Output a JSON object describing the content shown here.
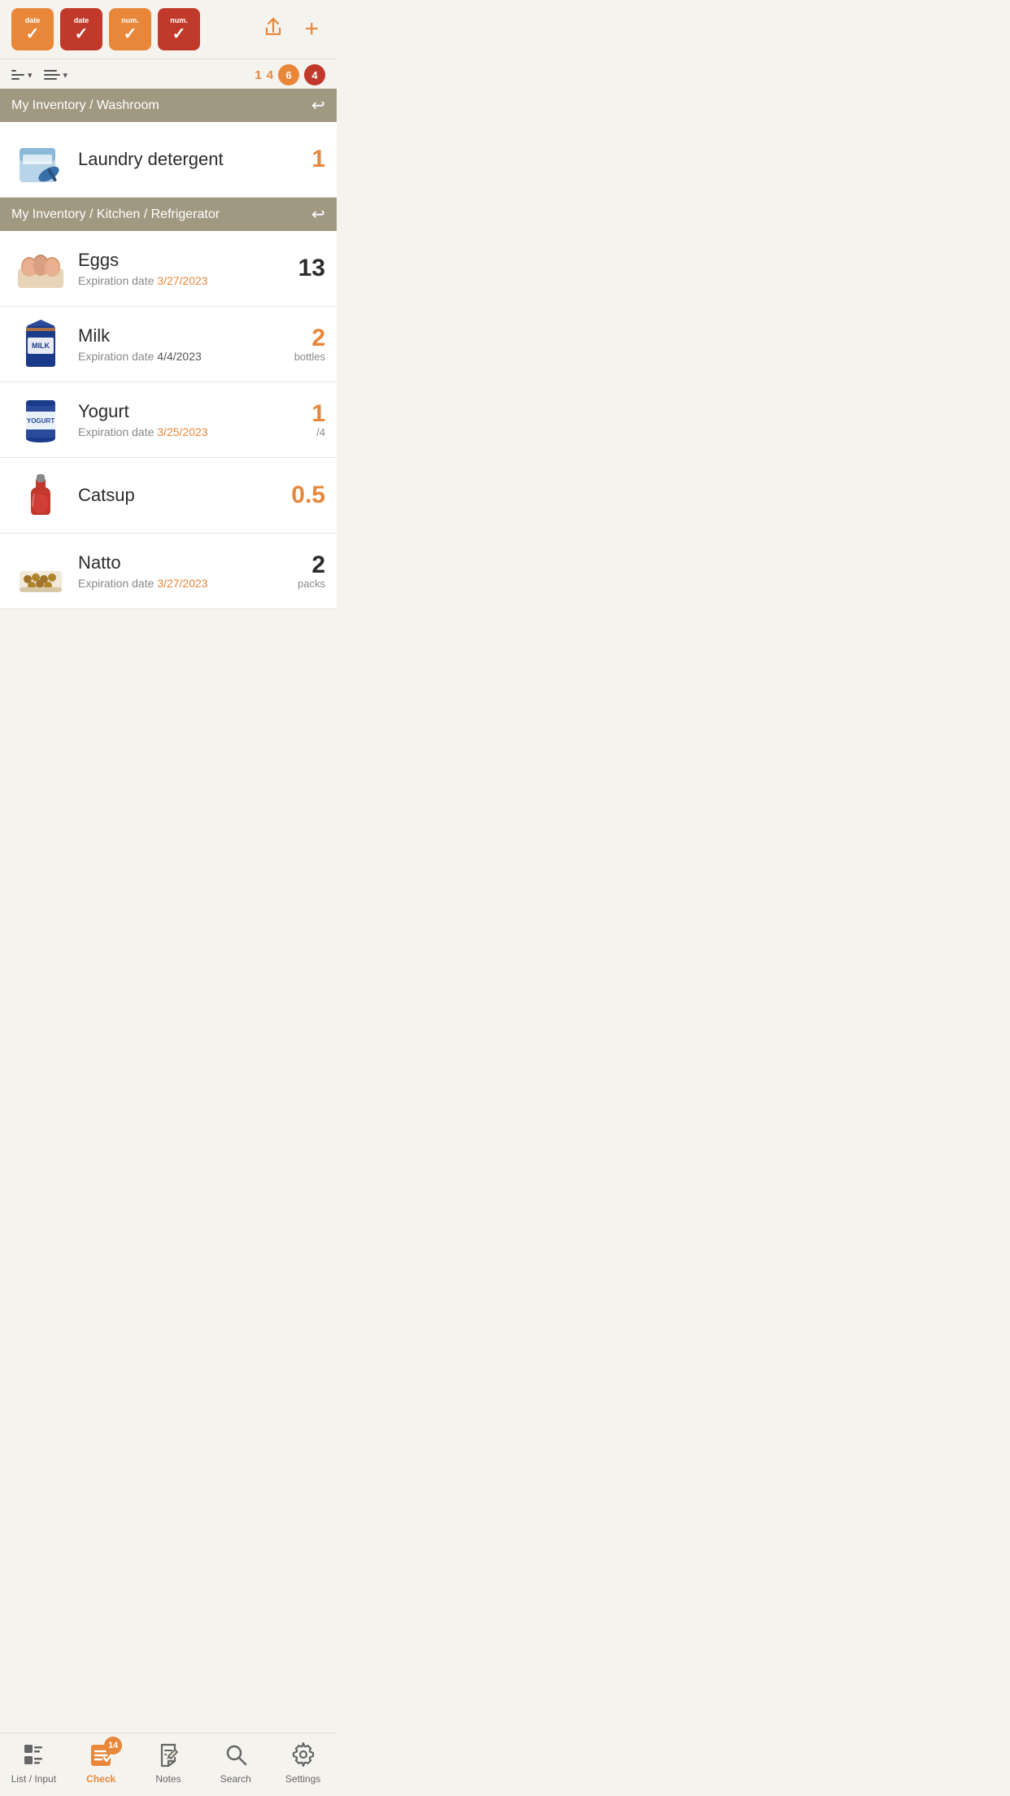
{
  "toolbar": {
    "filter_buttons": [
      {
        "label": "date",
        "type": "orange",
        "icon": "✓"
      },
      {
        "label": "date",
        "type": "red",
        "icon": "✓"
      },
      {
        "label": "num.",
        "type": "orange",
        "icon": "✓"
      },
      {
        "label": "num.",
        "type": "red",
        "icon": "✓"
      }
    ],
    "share_label": "Share",
    "add_label": "Add"
  },
  "sort_bar": {
    "sort1_label": "Sort by list",
    "sort2_label": "Sort by group",
    "counts": {
      "c1": "1",
      "c2": "4",
      "c3": "6",
      "c4": "4"
    }
  },
  "sections": [
    {
      "title": "My Inventory / Washroom",
      "items": [
        {
          "name": "Laundry detergent",
          "qty": "1",
          "qty_color": "orange",
          "unit": "",
          "expiry": "",
          "emoji": "🧺"
        }
      ]
    },
    {
      "title": "My Inventory / Kitchen / Refrigerator",
      "items": [
        {
          "name": "Eggs",
          "qty": "13",
          "qty_color": "dark",
          "unit": "",
          "expiry": "Expiration date",
          "expiry_date": "3/27/2023",
          "expiry_date_color": "orange",
          "emoji": "🥚"
        },
        {
          "name": "Milk",
          "qty": "2",
          "qty_color": "orange",
          "unit": "bottles",
          "expiry": "Expiration date",
          "expiry_date": "4/4/2023",
          "expiry_date_color": "normal",
          "emoji": "🥛"
        },
        {
          "name": "Yogurt",
          "qty": "1",
          "qty_color": "orange",
          "unit": "/4",
          "expiry": "Expiration date",
          "expiry_date": "3/25/2023",
          "expiry_date_color": "orange",
          "emoji": "🍶"
        },
        {
          "name": "Catsup",
          "qty": "0.5",
          "qty_color": "orange",
          "unit": "",
          "expiry": "",
          "expiry_date": "",
          "emoji": "🍅"
        },
        {
          "name": "Natto",
          "qty": "2",
          "qty_color": "dark",
          "unit": "packs",
          "expiry": "Expiration date",
          "expiry_date": "3/27/2023",
          "expiry_date_color": "orange",
          "emoji": "🫘"
        }
      ]
    }
  ],
  "bottom_nav": {
    "items": [
      {
        "id": "list",
        "label": "List / Input",
        "active": false,
        "badge": null
      },
      {
        "id": "check",
        "label": "Check",
        "active": true,
        "badge": "14"
      },
      {
        "id": "notes",
        "label": "Notes",
        "active": false,
        "badge": null
      },
      {
        "id": "search",
        "label": "Search",
        "active": false,
        "badge": null
      },
      {
        "id": "settings",
        "label": "Settings",
        "active": false,
        "badge": null
      }
    ]
  }
}
